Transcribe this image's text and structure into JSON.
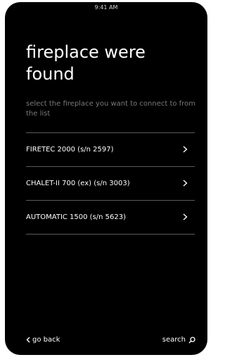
{
  "status_bar": {
    "time": "9:41 AM"
  },
  "header": {
    "title": "fireplace were found",
    "subtitle": "select the fireplace you want to connect to from the list"
  },
  "fireplaces": [
    {
      "label": "FIRETEC 2000 (s/n 2597)",
      "icon": "chevron-right-icon"
    },
    {
      "label": "CHALET-II 700 (ex) (s/n 3003)",
      "icon": "chevron-right-icon"
    },
    {
      "label": "AUTOMATIC 1500 (s/n 5623)",
      "icon": "chevron-right-icon"
    }
  ],
  "footer": {
    "back_label": "go back",
    "back_icon": "chevron-left-icon",
    "search_label": "search",
    "search_icon": "search-icon"
  },
  "colors": {
    "background": "#000000",
    "text": "#ffffff",
    "subtitle": "#7a7a7a",
    "divider": "#5a5a5a"
  }
}
